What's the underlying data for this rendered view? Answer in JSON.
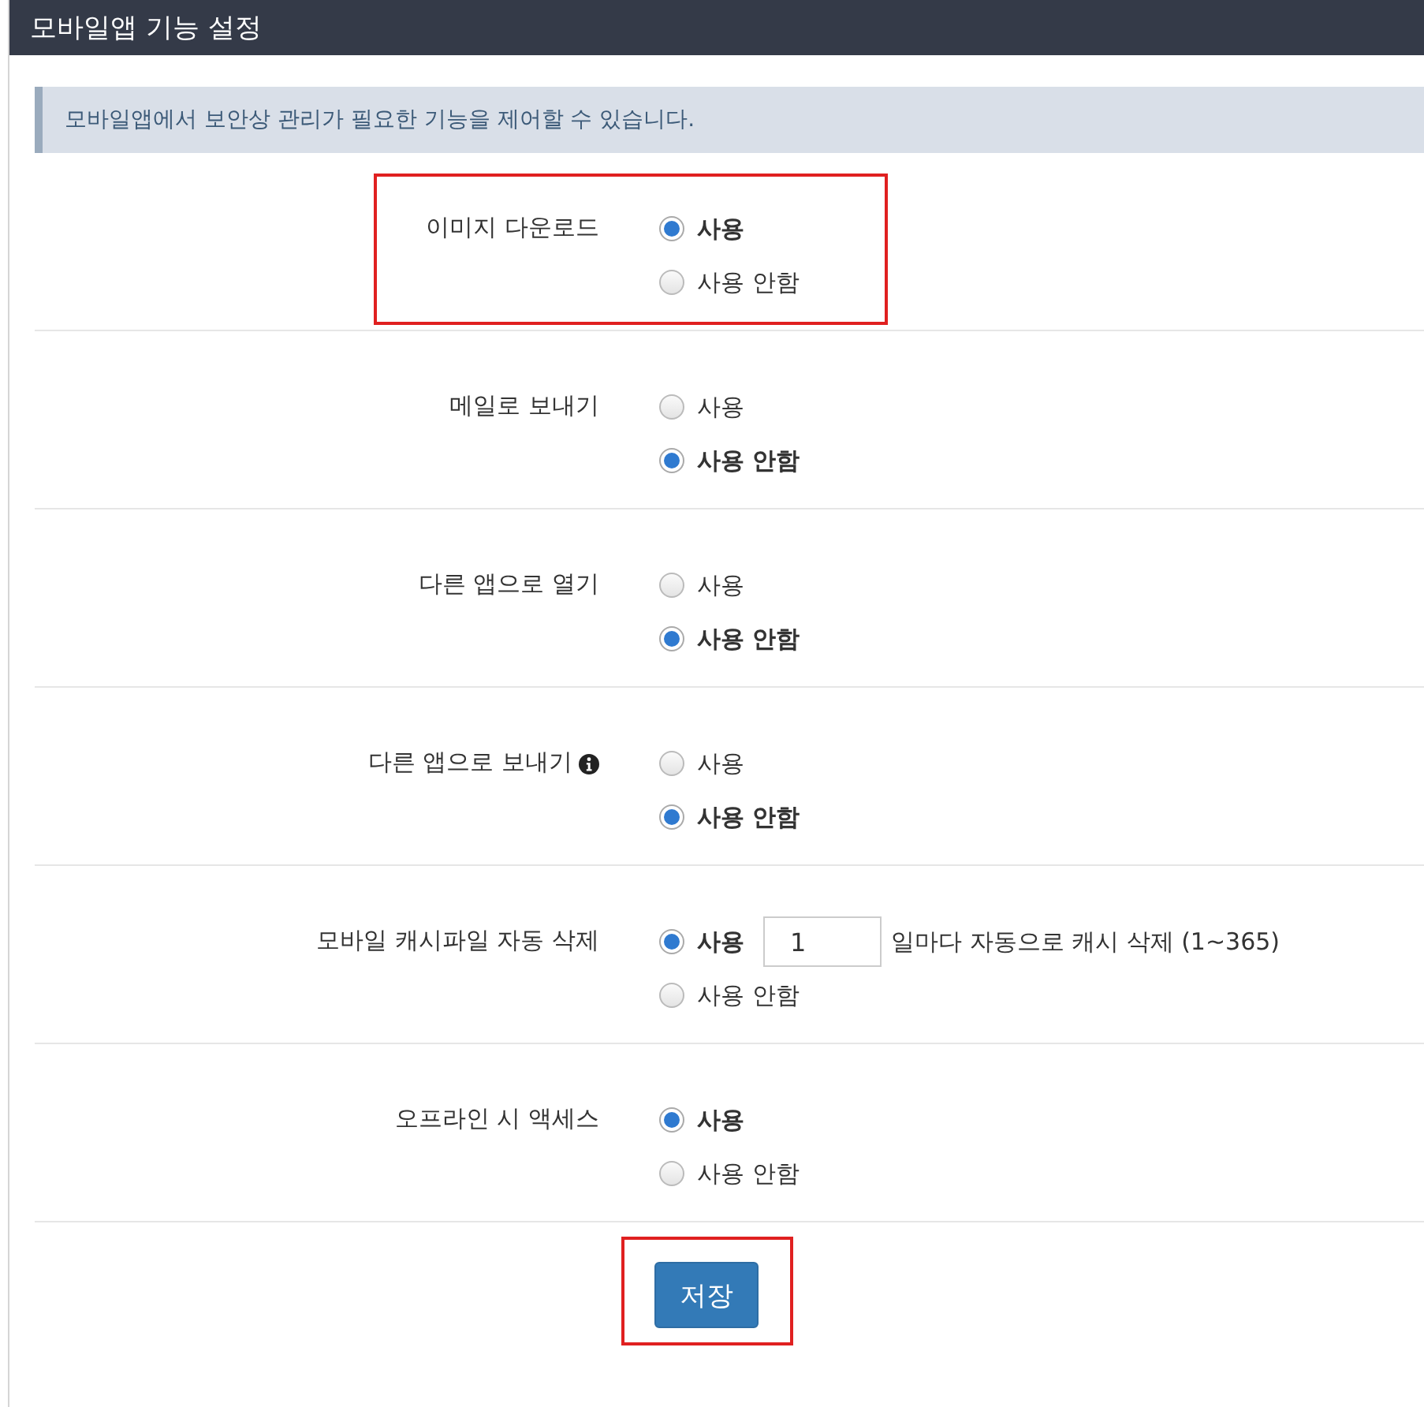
{
  "header": {
    "title": "모바일앱 기능 설정"
  },
  "notice": "모바일앱에서 보안상 관리가 필요한 기능을 제어할 수 있습니다.",
  "settings": [
    {
      "label": "이미지 다운로드",
      "info": false,
      "highlighted": true,
      "options": [
        {
          "label": "사용",
          "selected": true
        },
        {
          "label": "사용 안함",
          "selected": false
        }
      ]
    },
    {
      "label": "메일로 보내기",
      "info": false,
      "highlighted": false,
      "options": [
        {
          "label": "사용",
          "selected": false
        },
        {
          "label": "사용 안함",
          "selected": true
        }
      ]
    },
    {
      "label": "다른 앱으로 열기",
      "info": false,
      "highlighted": false,
      "options": [
        {
          "label": "사용",
          "selected": false
        },
        {
          "label": "사용 안함",
          "selected": true
        }
      ]
    },
    {
      "label": "다른 앱으로 보내기",
      "info": true,
      "highlighted": false,
      "options": [
        {
          "label": "사용",
          "selected": false
        },
        {
          "label": "사용 안함",
          "selected": true
        }
      ]
    },
    {
      "label": "모바일 캐시파일 자동 삭제",
      "info": false,
      "highlighted": false,
      "options": [
        {
          "label": "사용",
          "selected": true,
          "input_value": "1",
          "suffix": "일마다 자동으로 캐시 삭제 (1~365)"
        },
        {
          "label": "사용 안함",
          "selected": false
        }
      ]
    },
    {
      "label": "오프라인 시 액세스",
      "info": false,
      "highlighted": false,
      "options": [
        {
          "label": "사용",
          "selected": true
        },
        {
          "label": "사용 안함",
          "selected": false
        }
      ]
    }
  ],
  "save_button": {
    "label": "저장",
    "highlighted": true
  }
}
